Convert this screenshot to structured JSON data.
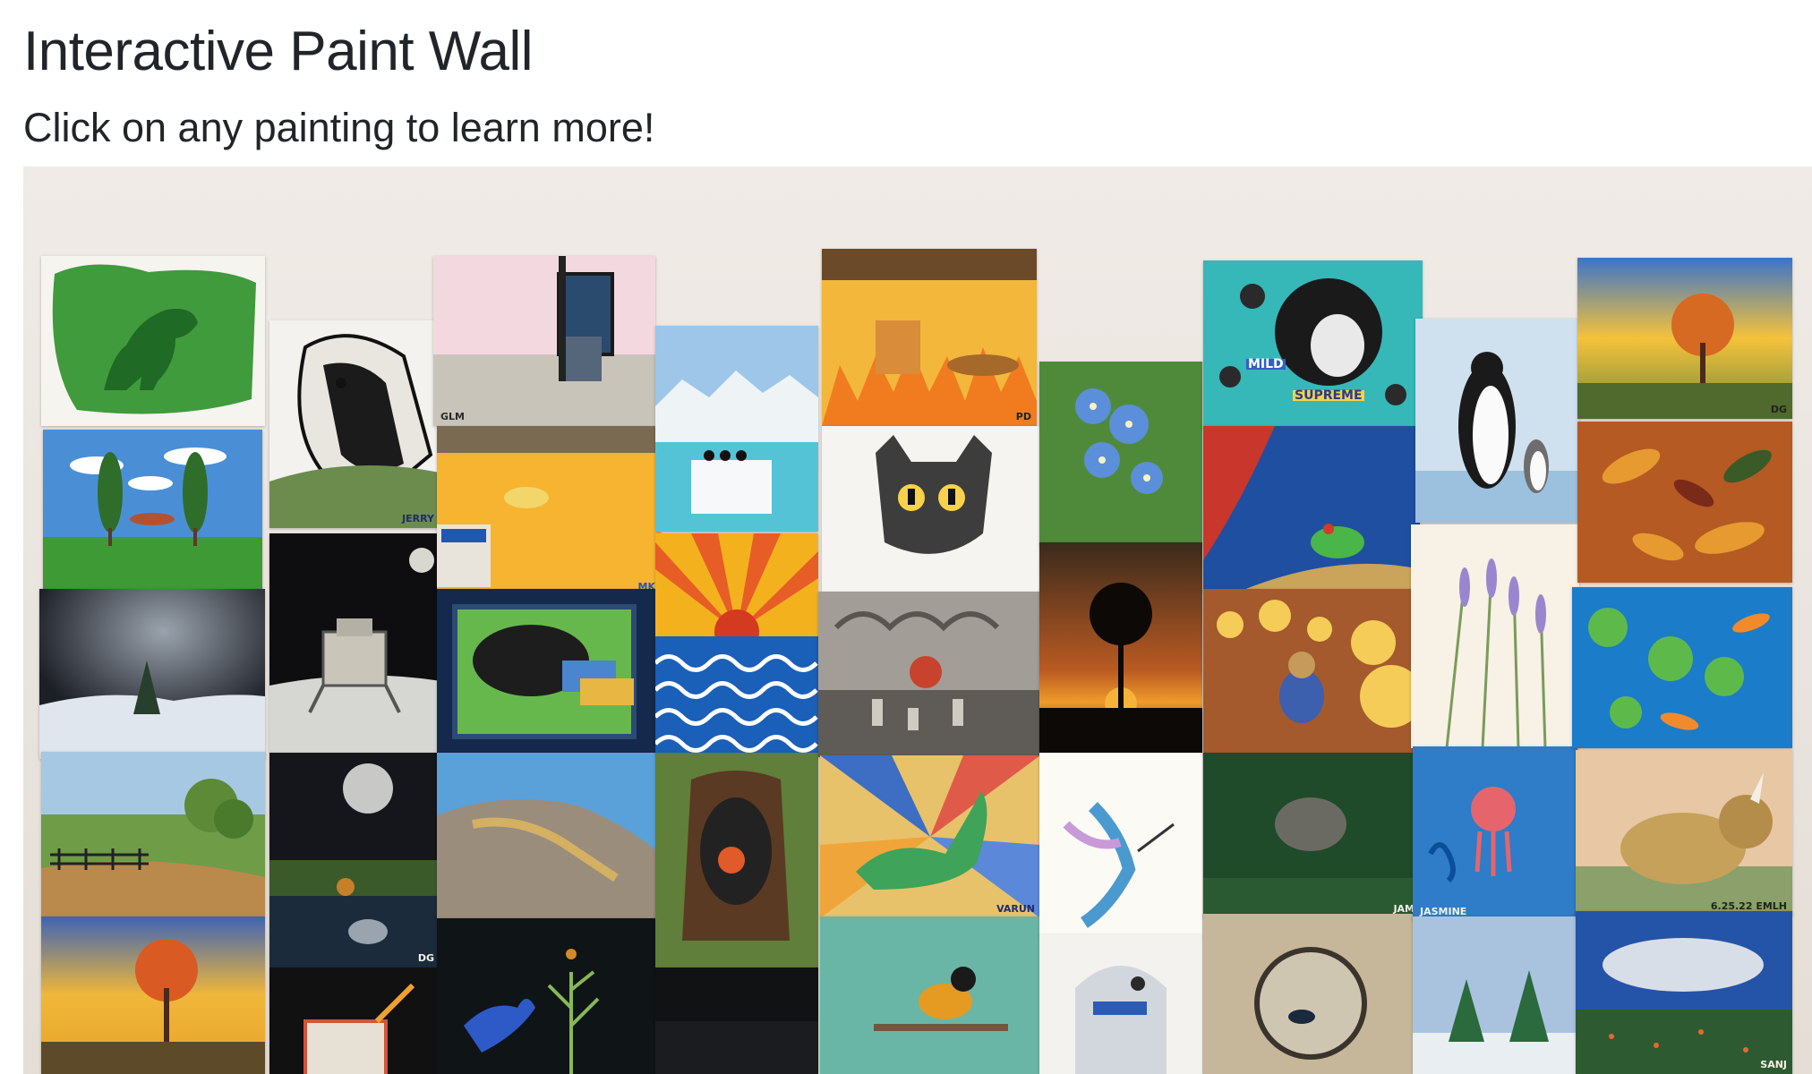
{
  "page": {
    "title": "Interactive Paint Wall",
    "subtitle": "Click on any painting to learn more!"
  },
  "paintings": [
    {
      "subject": "green dinosaur"
    },
    {
      "subject": "bear"
    },
    {
      "subject": "room with window",
      "signature": "GLM"
    },
    {
      "subject": "snowy mountains"
    },
    {
      "subject": "this is fine dog",
      "signature": "PD"
    },
    {
      "subject": "blue flowers"
    },
    {
      "subject": "penguin collage",
      "collage_words": [
        "MILD",
        "SUPREME"
      ]
    },
    {
      "subject": "emperor penguins"
    },
    {
      "subject": "autumn tree",
      "signature": "DG"
    },
    {
      "subject": "trees and hot dog"
    },
    {
      "subject": "duck in pool",
      "signature": "MK"
    },
    {
      "subject": "penguins on iceberg"
    },
    {
      "subject": "cartoon cat"
    },
    {
      "subject": "frog on red curtain"
    },
    {
      "subject": "lavender"
    },
    {
      "subject": "autumn leaves"
    },
    {
      "subject": "astronaut on moon"
    },
    {
      "subject": "winter night"
    },
    {
      "subject": "sleeping dog"
    },
    {
      "subject": "sunset over waves"
    },
    {
      "subject": "dream clouds"
    },
    {
      "subject": "sunset silhouette"
    },
    {
      "subject": "bear with lanterns"
    },
    {
      "subject": "koi pond"
    },
    {
      "subject": "landscape with fence"
    },
    {
      "subject": "moon reflection",
      "signature": "DG"
    },
    {
      "subject": "lizard on rock"
    },
    {
      "subject": "tree stump"
    },
    {
      "subject": "dinosaur with rays",
      "signature": "VARUN"
    },
    {
      "subject": "hummingbird"
    },
    {
      "subject": "hedgehog",
      "signature": "JAM"
    },
    {
      "subject": "jellyfish",
      "signature": "JASMINE"
    },
    {
      "subject": "triceratops",
      "signature": "6.25.22  EMLH"
    },
    {
      "subject": "autumn tree at dusk"
    },
    {
      "subject": "juice box"
    },
    {
      "subject": "betta fish"
    },
    {
      "subject": "dark painting"
    },
    {
      "subject": "oriole bird"
    },
    {
      "subject": "robot"
    },
    {
      "subject": "whale in globe"
    },
    {
      "subject": "winter pines"
    },
    {
      "subject": "cloudy field",
      "signature": "SANJ"
    }
  ]
}
